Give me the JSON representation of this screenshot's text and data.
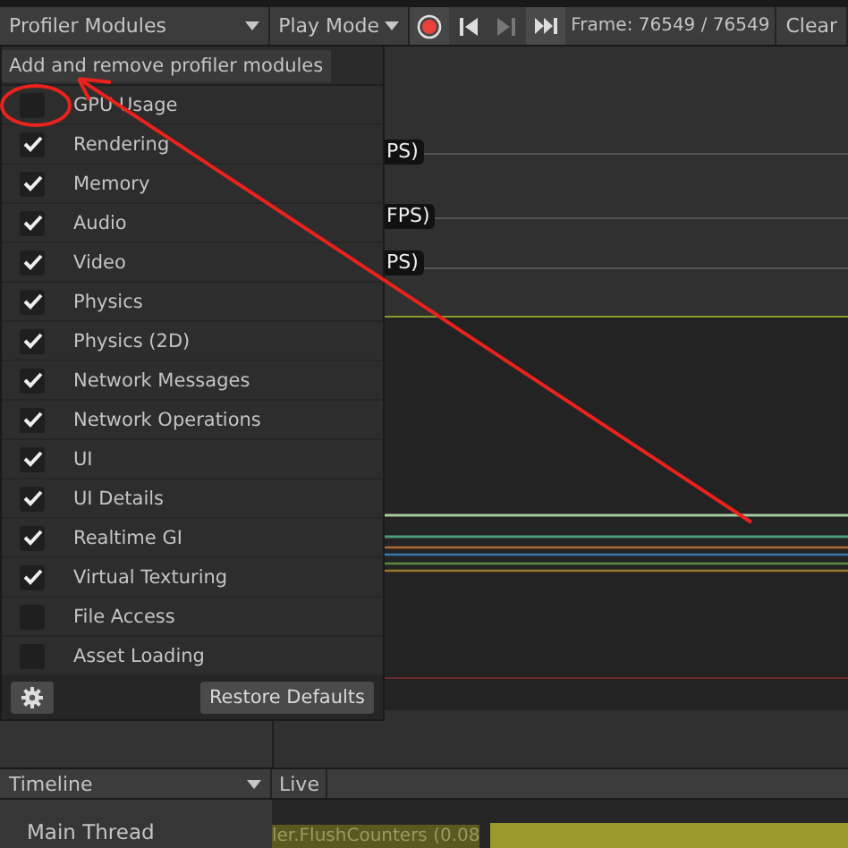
{
  "toolbar": {
    "modules_dropdown": "Profiler Modules",
    "play_mode": "Play Mode",
    "recording": true,
    "frame": "Frame: 76549 / 76549",
    "clear": "Clear"
  },
  "chart": {
    "labels": [
      "PS)",
      "FPS)",
      "PS)"
    ]
  },
  "menu": {
    "title": "Add and remove profiler modules",
    "modules": [
      {
        "label": "GPU Usage",
        "checked": false
      },
      {
        "label": "Rendering",
        "checked": true
      },
      {
        "label": "Memory",
        "checked": true
      },
      {
        "label": "Audio",
        "checked": true
      },
      {
        "label": "Video",
        "checked": true
      },
      {
        "label": "Physics",
        "checked": true
      },
      {
        "label": "Physics (2D)",
        "checked": true
      },
      {
        "label": "Network Messages",
        "checked": true
      },
      {
        "label": "Network Operations",
        "checked": true
      },
      {
        "label": "UI",
        "checked": true
      },
      {
        "label": "UI Details",
        "checked": true
      },
      {
        "label": "Realtime GI",
        "checked": true
      },
      {
        "label": "Virtual Texturing",
        "checked": true
      },
      {
        "label": "File Access",
        "checked": false
      },
      {
        "label": "Asset Loading",
        "checked": false
      }
    ],
    "restore": "Restore Defaults"
  },
  "timeline": {
    "view": "Timeline",
    "live": "Live",
    "thread": "Main Thread",
    "marker": "ler.FlushCounters (0.08"
  }
}
